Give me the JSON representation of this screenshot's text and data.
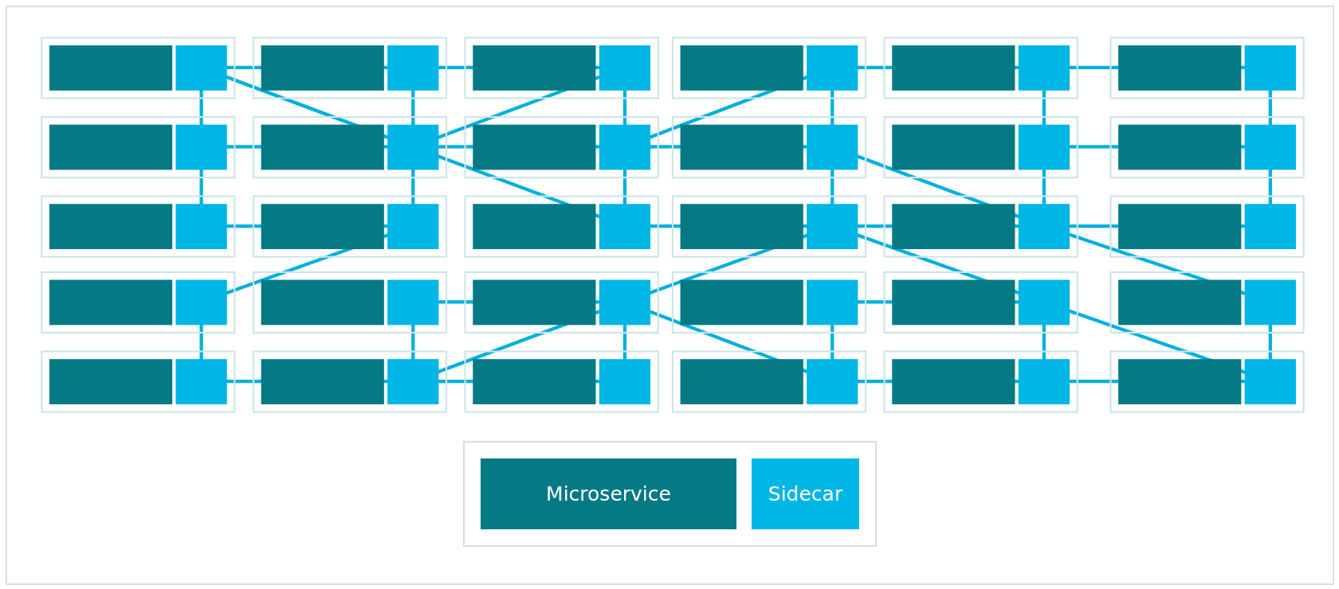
{
  "legend": [
    {
      "kind": "microservice",
      "label": "Microservice"
    },
    {
      "kind": "sidecar",
      "label": "Sidecar"
    }
  ]
}
